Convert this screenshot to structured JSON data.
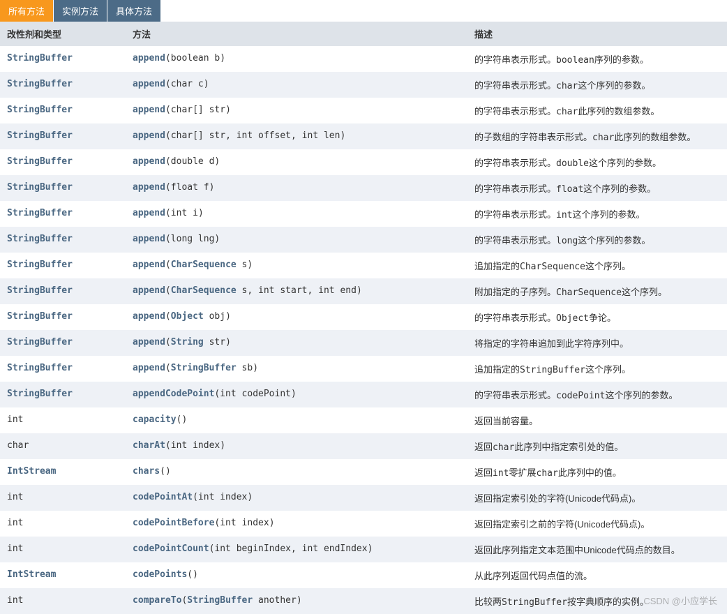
{
  "tabs": [
    "所有方法",
    "实例方法",
    "具体方法"
  ],
  "headers": {
    "modifier": "改性剂和类型",
    "method": "方法",
    "description": "描述"
  },
  "watermark": "CSDN @小应学长",
  "rows": [
    {
      "returnType": "StringBuffer",
      "returnLink": true,
      "methodName": "append",
      "params": [
        {
          "type": "boolean",
          "name": "b"
        }
      ],
      "desc": [
        {
          "t": "的字符串表示形式。"
        },
        {
          "t": "boolean",
          "c": true
        },
        {
          "t": "序列的参数。"
        }
      ]
    },
    {
      "returnType": "StringBuffer",
      "returnLink": true,
      "methodName": "append",
      "params": [
        {
          "type": "char",
          "name": "c"
        }
      ],
      "desc": [
        {
          "t": "的字符串表示形式。"
        },
        {
          "t": "char",
          "c": true
        },
        {
          "t": "这个序列的参数。"
        }
      ]
    },
    {
      "returnType": "StringBuffer",
      "returnLink": true,
      "methodName": "append",
      "params": [
        {
          "type": "char[]",
          "name": "str"
        }
      ],
      "desc": [
        {
          "t": "的字符串表示形式。"
        },
        {
          "t": "char",
          "c": true
        },
        {
          "t": "此序列的数组参数。"
        }
      ]
    },
    {
      "returnType": "StringBuffer",
      "returnLink": true,
      "methodName": "append",
      "params": [
        {
          "type": "char[]",
          "name": "str"
        },
        {
          "type": "int",
          "name": "offset"
        },
        {
          "type": "int",
          "name": "len"
        }
      ],
      "desc": [
        {
          "t": "的子数组的字符串表示形式。"
        },
        {
          "t": "char",
          "c": true
        },
        {
          "t": "此序列的数组参数。"
        }
      ]
    },
    {
      "returnType": "StringBuffer",
      "returnLink": true,
      "methodName": "append",
      "params": [
        {
          "type": "double",
          "name": "d"
        }
      ],
      "desc": [
        {
          "t": "的字符串表示形式。"
        },
        {
          "t": "double",
          "c": true
        },
        {
          "t": "这个序列的参数。"
        }
      ]
    },
    {
      "returnType": "StringBuffer",
      "returnLink": true,
      "methodName": "append",
      "params": [
        {
          "type": "float",
          "name": "f"
        }
      ],
      "desc": [
        {
          "t": "的字符串表示形式。"
        },
        {
          "t": "float",
          "c": true
        },
        {
          "t": "这个序列的参数。"
        }
      ]
    },
    {
      "returnType": "StringBuffer",
      "returnLink": true,
      "methodName": "append",
      "params": [
        {
          "type": "int",
          "name": "i"
        }
      ],
      "desc": [
        {
          "t": "的字符串表示形式。"
        },
        {
          "t": "int",
          "c": true
        },
        {
          "t": "这个序列的参数。"
        }
      ]
    },
    {
      "returnType": "StringBuffer",
      "returnLink": true,
      "methodName": "append",
      "params": [
        {
          "type": "long",
          "name": "lng"
        }
      ],
      "desc": [
        {
          "t": "的字符串表示形式。"
        },
        {
          "t": "long",
          "c": true
        },
        {
          "t": "这个序列的参数。"
        }
      ]
    },
    {
      "returnType": "StringBuffer",
      "returnLink": true,
      "methodName": "append",
      "params": [
        {
          "type": "CharSequence",
          "typeLink": true,
          "name": "s"
        }
      ],
      "desc": [
        {
          "t": "追加指定的"
        },
        {
          "t": "CharSequence",
          "c": true
        },
        {
          "t": "这个序列。"
        }
      ]
    },
    {
      "returnType": "StringBuffer",
      "returnLink": true,
      "methodName": "append",
      "params": [
        {
          "type": "CharSequence",
          "typeLink": true,
          "name": "s"
        },
        {
          "type": "int",
          "name": "start"
        },
        {
          "type": "int",
          "name": "end"
        }
      ],
      "desc": [
        {
          "t": "附加指定的子序列。"
        },
        {
          "t": "CharSequence",
          "c": true
        },
        {
          "t": "这个序列。"
        }
      ]
    },
    {
      "returnType": "StringBuffer",
      "returnLink": true,
      "methodName": "append",
      "params": [
        {
          "type": "Object",
          "typeLink": true,
          "name": "obj"
        }
      ],
      "desc": [
        {
          "t": "的字符串表示形式。"
        },
        {
          "t": "Object",
          "c": true
        },
        {
          "t": "争论。"
        }
      ]
    },
    {
      "returnType": "StringBuffer",
      "returnLink": true,
      "methodName": "append",
      "params": [
        {
          "type": "String",
          "typeLink": true,
          "name": "str"
        }
      ],
      "desc": [
        {
          "t": "将指定的字符串追加到此字符序列中。"
        }
      ]
    },
    {
      "returnType": "StringBuffer",
      "returnLink": true,
      "methodName": "append",
      "params": [
        {
          "type": "StringBuffer",
          "typeLink": true,
          "name": "sb"
        }
      ],
      "desc": [
        {
          "t": "追加指定的"
        },
        {
          "t": "StringBuffer",
          "c": true
        },
        {
          "t": "这个序列。"
        }
      ]
    },
    {
      "returnType": "StringBuffer",
      "returnLink": true,
      "methodName": "appendCodePoint",
      "params": [
        {
          "type": "int",
          "name": "codePoint"
        }
      ],
      "desc": [
        {
          "t": "的字符串表示形式。"
        },
        {
          "t": "codePoint",
          "c": true
        },
        {
          "t": "这个序列的参数。"
        }
      ]
    },
    {
      "returnType": "int",
      "returnLink": false,
      "methodName": "capacity",
      "params": [],
      "desc": [
        {
          "t": "返回当前容量。"
        }
      ]
    },
    {
      "returnType": "char",
      "returnLink": false,
      "methodName": "charAt",
      "params": [
        {
          "type": "int",
          "name": "index"
        }
      ],
      "desc": [
        {
          "t": "返回"
        },
        {
          "t": "char",
          "c": true
        },
        {
          "t": "此序列中指定索引处的值。"
        }
      ]
    },
    {
      "returnType": "IntStream",
      "returnLink": true,
      "methodName": "chars",
      "params": [],
      "desc": [
        {
          "t": "返回"
        },
        {
          "t": "int",
          "c": true
        },
        {
          "t": "零扩展"
        },
        {
          "t": "char",
          "c": true
        },
        {
          "t": "此序列中的值。"
        }
      ]
    },
    {
      "returnType": "int",
      "returnLink": false,
      "methodName": "codePointAt",
      "params": [
        {
          "type": "int",
          "name": "index"
        }
      ],
      "desc": [
        {
          "t": "返回指定索引处的字符(Unicode代码点)。"
        }
      ]
    },
    {
      "returnType": "int",
      "returnLink": false,
      "methodName": "codePointBefore",
      "params": [
        {
          "type": "int",
          "name": "index"
        }
      ],
      "desc": [
        {
          "t": "返回指定索引之前的字符(Unicode代码点)。"
        }
      ]
    },
    {
      "returnType": "int",
      "returnLink": false,
      "methodName": "codePointCount",
      "params": [
        {
          "type": "int",
          "name": "beginIndex"
        },
        {
          "type": "int",
          "name": "endIndex"
        }
      ],
      "desc": [
        {
          "t": "返回此序列指定文本范围中Unicode代码点的数目。"
        }
      ]
    },
    {
      "returnType": "IntStream",
      "returnLink": true,
      "methodName": "codePoints",
      "params": [],
      "desc": [
        {
          "t": "从此序列返回代码点值的流。"
        }
      ]
    },
    {
      "returnType": "int",
      "returnLink": false,
      "methodName": "compareTo",
      "params": [
        {
          "type": "StringBuffer",
          "typeLink": true,
          "name": "another"
        }
      ],
      "desc": [
        {
          "t": "比较两"
        },
        {
          "t": "StringBuffer",
          "c": true
        },
        {
          "t": "按字典顺序的实例。"
        }
      ]
    }
  ]
}
